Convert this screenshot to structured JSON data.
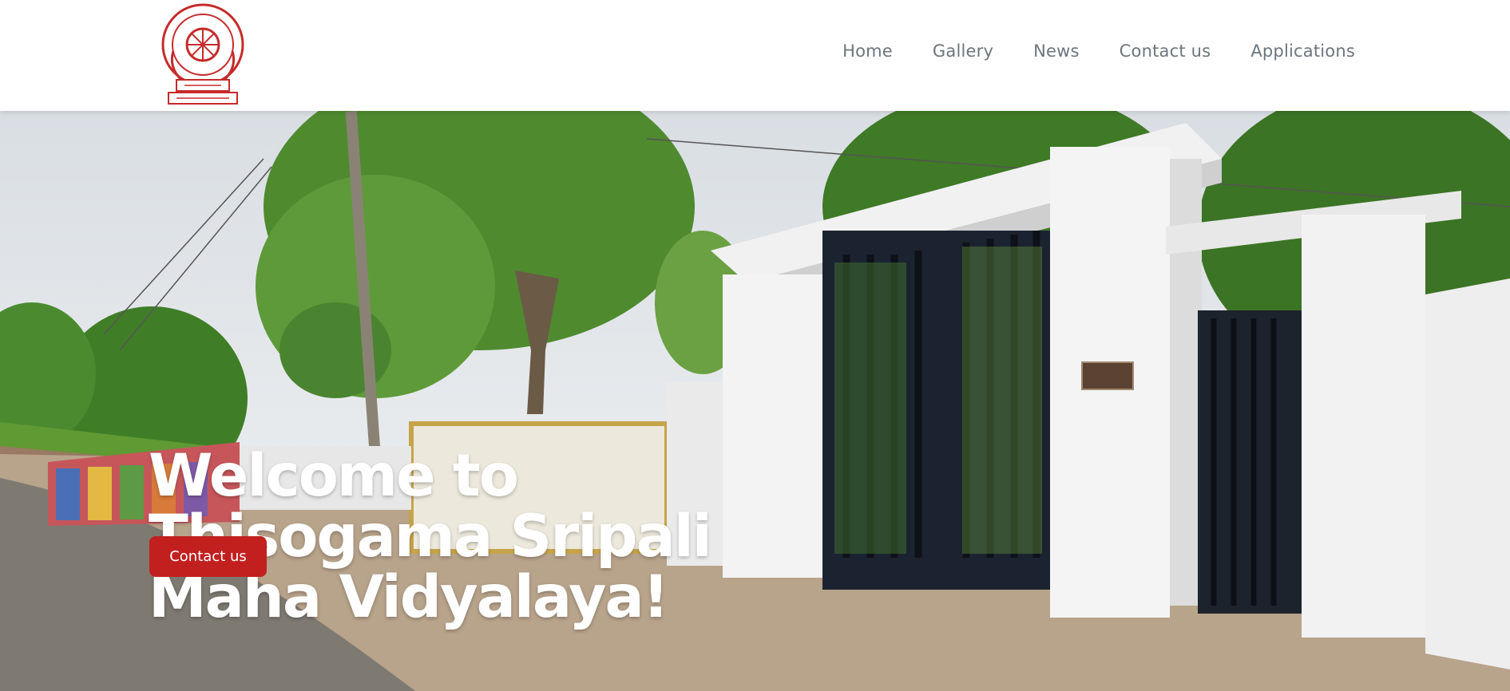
{
  "header": {
    "logo_icon": "school-crest-icon",
    "nav": [
      {
        "label": "Home"
      },
      {
        "label": "Gallery"
      },
      {
        "label": "News"
      },
      {
        "label": "Contact us"
      },
      {
        "label": "Applications"
      }
    ]
  },
  "hero": {
    "title": "Welcome to Thisogama Sripali Maha Vidyalaya!",
    "cta_label": "Contact us"
  },
  "colors": {
    "accent": "#c1201f",
    "nav_text": "#6c757d",
    "title_text": "#ffffff"
  }
}
